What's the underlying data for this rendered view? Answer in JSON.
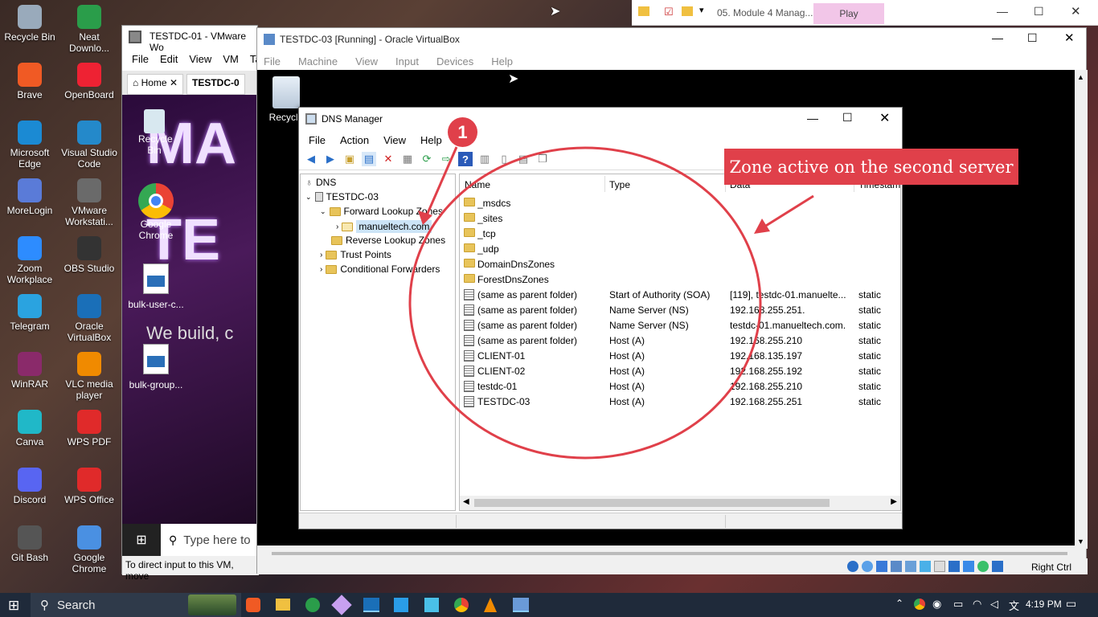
{
  "desktop_icons": [
    {
      "label": "Recycle Bin",
      "icon": "recycle-bin-icon",
      "color": "#9ab"
    },
    {
      "label": "Neat Downlo...",
      "icon": "neat-download-icon",
      "color": "#2a9d4a"
    },
    {
      "label": "Brave",
      "icon": "brave-icon",
      "color": "#f05a24"
    },
    {
      "label": "OpenBoard",
      "icon": "openboard-icon",
      "color": "#e23"
    },
    {
      "label": "Microsoft Edge",
      "icon": "edge-icon",
      "color": "#1b8ad3"
    },
    {
      "label": "Visual Studio Code",
      "icon": "vscode-icon",
      "color": "#2489ca"
    },
    {
      "label": "MoreLogin",
      "icon": "morelogin-icon",
      "color": "#5a7bd8"
    },
    {
      "label": "VMware Workstati...",
      "icon": "vmware-icon",
      "color": "#6a6a6a"
    },
    {
      "label": "Zoom Workplace",
      "icon": "zoom-icon",
      "color": "#2d8cff"
    },
    {
      "label": "OBS Studio",
      "icon": "obs-icon",
      "color": "#333"
    },
    {
      "label": "Telegram",
      "icon": "telegram-icon",
      "color": "#2aa3e0"
    },
    {
      "label": "Oracle VirtualBox",
      "icon": "virtualbox-icon",
      "color": "#1a6fb8"
    },
    {
      "label": "WinRAR",
      "icon": "winrar-icon",
      "color": "#8a2a6a"
    },
    {
      "label": "VLC media player",
      "icon": "vlc-icon",
      "color": "#f08a00"
    },
    {
      "label": "Canva",
      "icon": "canva-icon",
      "color": "#20b8c8"
    },
    {
      "label": "WPS PDF",
      "icon": "wps-pdf-icon",
      "color": "#e02a2a"
    },
    {
      "label": "Discord",
      "icon": "discord-icon",
      "color": "#5865f2"
    },
    {
      "label": "WPS Office",
      "icon": "wps-office-icon",
      "color": "#e02a2a"
    },
    {
      "label": "Git Bash",
      "icon": "git-bash-icon",
      "color": "#555"
    },
    {
      "label": "Google Chrome",
      "icon": "chrome-icon",
      "color": "#4a90e2"
    }
  ],
  "vmware": {
    "title": "TESTDC-01 - VMware Wo",
    "menu": [
      "File",
      "Edit",
      "View",
      "VM",
      "Ta"
    ],
    "tab_home": "Home",
    "tab_vm": "TESTDC-0",
    "guest_icons": [
      "Recycle Bin",
      "Google Chrome",
      "bulk-user-c...",
      "bulk-group..."
    ],
    "banner": [
      "MA",
      "TE",
      "We build, c"
    ],
    "guest_search": "Type here to",
    "status": "To direct input to this VM, move"
  },
  "vbox": {
    "title": "TESTDC-03 [Running] - Oracle VirtualBox",
    "menu": [
      "File",
      "Machine",
      "View",
      "Input",
      "Devices",
      "Help"
    ],
    "guest_recycle": "Recycle",
    "host_key": "Right Ctrl"
  },
  "dns": {
    "title": "DNS Manager",
    "menu": [
      "File",
      "Action",
      "View",
      "Help"
    ],
    "tree": {
      "root": "DNS",
      "server": "TESTDC-03",
      "forward": "Forward Lookup Zones",
      "zone": "manueltech.com",
      "reverse": "Reverse Lookup Zones",
      "trust": "Trust Points",
      "conditional": "Conditional Forwarders"
    },
    "columns": [
      "Name",
      "Type",
      "Data",
      "Timestam"
    ],
    "records": [
      {
        "name": "_msdcs",
        "type": "",
        "data": "",
        "ts": "",
        "kind": "folder"
      },
      {
        "name": "_sites",
        "type": "",
        "data": "",
        "ts": "",
        "kind": "folder"
      },
      {
        "name": "_tcp",
        "type": "",
        "data": "",
        "ts": "",
        "kind": "folder"
      },
      {
        "name": "_udp",
        "type": "",
        "data": "",
        "ts": "",
        "kind": "folder"
      },
      {
        "name": "DomainDnsZones",
        "type": "",
        "data": "",
        "ts": "",
        "kind": "folder"
      },
      {
        "name": "ForestDnsZones",
        "type": "",
        "data": "",
        "ts": "",
        "kind": "folder"
      },
      {
        "name": "(same as parent folder)",
        "type": "Start of Authority (SOA)",
        "data": "[119], testdc-01.manuelte...",
        "ts": "static",
        "kind": "record"
      },
      {
        "name": "(same as parent folder)",
        "type": "Name Server (NS)",
        "data": "192.168.255.251.",
        "ts": "static",
        "kind": "record"
      },
      {
        "name": "(same as parent folder)",
        "type": "Name Server (NS)",
        "data": "testdc-01.manueltech.com.",
        "ts": "static",
        "kind": "record"
      },
      {
        "name": "(same as parent folder)",
        "type": "Host (A)",
        "data": "192.168.255.210",
        "ts": "static",
        "kind": "record"
      },
      {
        "name": "CLIENT-01",
        "type": "Host (A)",
        "data": "192.168.135.197",
        "ts": "static",
        "kind": "record"
      },
      {
        "name": "CLIENT-02",
        "type": "Host (A)",
        "data": "192.168.255.192",
        "ts": "static",
        "kind": "record"
      },
      {
        "name": "testdc-01",
        "type": "Host (A)",
        "data": "192.168.255.210",
        "ts": "static",
        "kind": "record"
      },
      {
        "name": "TESTDC-03",
        "type": "Host (A)",
        "data": "192.168.255.251",
        "ts": "static",
        "kind": "record"
      }
    ]
  },
  "annotations": {
    "callout": "Zone active on the second server",
    "badge": "1",
    "color": "#e0404a"
  },
  "top_window": {
    "title": "05. Module 4 Manag...",
    "play": "Play"
  },
  "taskbar": {
    "search": "Search",
    "clock": "4:19 PM"
  }
}
